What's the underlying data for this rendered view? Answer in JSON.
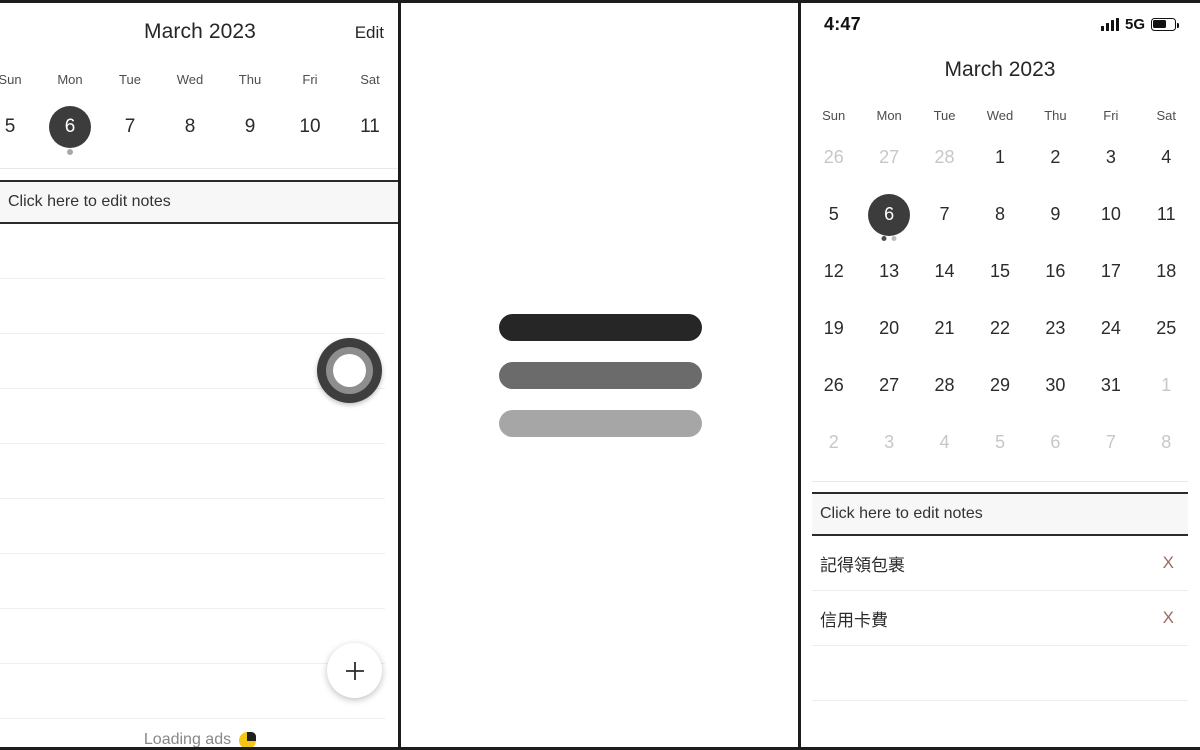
{
  "left_panel": {
    "header": {
      "title": "March 2023",
      "edit_label": "Edit"
    },
    "weekdays": [
      "Sun",
      "Mon",
      "Tue",
      "Wed",
      "Thu",
      "Fri",
      "Sat"
    ],
    "week_dates": [
      {
        "day": "5",
        "selected": false,
        "dots": 0
      },
      {
        "day": "6",
        "selected": true,
        "dots": 1
      },
      {
        "day": "7",
        "selected": false,
        "dots": 0
      },
      {
        "day": "8",
        "selected": false,
        "dots": 0
      },
      {
        "day": "9",
        "selected": false,
        "dots": 0
      },
      {
        "day": "10",
        "selected": false,
        "dots": 0
      },
      {
        "day": "11",
        "selected": false,
        "dots": 0
      }
    ],
    "notes_placeholder": "Click here to edit notes",
    "spinner_icon": "loading-ring-icon",
    "add_icon": "plus-icon",
    "ad_text": "Loading ads",
    "ad_icon": "ad-badge-icon"
  },
  "middle_panel": {
    "bars": [
      {
        "name": "bar-dark",
        "color": "#262626"
      },
      {
        "name": "bar-medium",
        "color": "#6b6b6b"
      },
      {
        "name": "bar-light",
        "color": "#a6a6a6"
      }
    ]
  },
  "right_panel": {
    "status_bar": {
      "time": "4:47",
      "signal_icon": "cellular-signal-icon",
      "network": "5G",
      "battery_icon": "battery-icon",
      "battery_level_percent": 60
    },
    "header": {
      "title": "March 2023"
    },
    "weekdays": [
      "Sun",
      "Mon",
      "Tue",
      "Wed",
      "Thu",
      "Fri",
      "Sat"
    ],
    "grid": [
      {
        "day": "26",
        "out": true,
        "selected": false,
        "dots": 0
      },
      {
        "day": "27",
        "out": true,
        "selected": false,
        "dots": 0
      },
      {
        "day": "28",
        "out": true,
        "selected": false,
        "dots": 0
      },
      {
        "day": "1",
        "out": false,
        "selected": false,
        "dots": 0
      },
      {
        "day": "2",
        "out": false,
        "selected": false,
        "dots": 0
      },
      {
        "day": "3",
        "out": false,
        "selected": false,
        "dots": 0
      },
      {
        "day": "4",
        "out": false,
        "selected": false,
        "dots": 0
      },
      {
        "day": "5",
        "out": false,
        "selected": false,
        "dots": 0
      },
      {
        "day": "6",
        "out": false,
        "selected": true,
        "dots": 2
      },
      {
        "day": "7",
        "out": false,
        "selected": false,
        "dots": 0
      },
      {
        "day": "8",
        "out": false,
        "selected": false,
        "dots": 0
      },
      {
        "day": "9",
        "out": false,
        "selected": false,
        "dots": 0
      },
      {
        "day": "10",
        "out": false,
        "selected": false,
        "dots": 0
      },
      {
        "day": "11",
        "out": false,
        "selected": false,
        "dots": 0
      },
      {
        "day": "12",
        "out": false,
        "selected": false,
        "dots": 0
      },
      {
        "day": "13",
        "out": false,
        "selected": false,
        "dots": 0
      },
      {
        "day": "14",
        "out": false,
        "selected": false,
        "dots": 0
      },
      {
        "day": "15",
        "out": false,
        "selected": false,
        "dots": 0
      },
      {
        "day": "16",
        "out": false,
        "selected": false,
        "dots": 0
      },
      {
        "day": "17",
        "out": false,
        "selected": false,
        "dots": 0
      },
      {
        "day": "18",
        "out": false,
        "selected": false,
        "dots": 0
      },
      {
        "day": "19",
        "out": false,
        "selected": false,
        "dots": 0
      },
      {
        "day": "20",
        "out": false,
        "selected": false,
        "dots": 0
      },
      {
        "day": "21",
        "out": false,
        "selected": false,
        "dots": 0
      },
      {
        "day": "22",
        "out": false,
        "selected": false,
        "dots": 0
      },
      {
        "day": "23",
        "out": false,
        "selected": false,
        "dots": 0
      },
      {
        "day": "24",
        "out": false,
        "selected": false,
        "dots": 0
      },
      {
        "day": "25",
        "out": false,
        "selected": false,
        "dots": 0
      },
      {
        "day": "26",
        "out": false,
        "selected": false,
        "dots": 0
      },
      {
        "day": "27",
        "out": false,
        "selected": false,
        "dots": 0
      },
      {
        "day": "28",
        "out": false,
        "selected": false,
        "dots": 0
      },
      {
        "day": "29",
        "out": false,
        "selected": false,
        "dots": 0
      },
      {
        "day": "30",
        "out": false,
        "selected": false,
        "dots": 0
      },
      {
        "day": "31",
        "out": false,
        "selected": false,
        "dots": 0
      },
      {
        "day": "1",
        "out": true,
        "selected": false,
        "dots": 0
      },
      {
        "day": "2",
        "out": true,
        "selected": false,
        "dots": 0
      },
      {
        "day": "3",
        "out": true,
        "selected": false,
        "dots": 0
      },
      {
        "day": "4",
        "out": true,
        "selected": false,
        "dots": 0
      },
      {
        "day": "5",
        "out": true,
        "selected": false,
        "dots": 0
      },
      {
        "day": "6",
        "out": true,
        "selected": false,
        "dots": 0
      },
      {
        "day": "7",
        "out": true,
        "selected": false,
        "dots": 0
      },
      {
        "day": "8",
        "out": true,
        "selected": false,
        "dots": 0
      }
    ],
    "notes_placeholder": "Click here to edit notes",
    "notes": [
      {
        "text": "記得領包裹",
        "delete_label": "X"
      },
      {
        "text": "信用卡費",
        "delete_label": "X"
      }
    ],
    "delete_color": "#9c6b5f"
  }
}
